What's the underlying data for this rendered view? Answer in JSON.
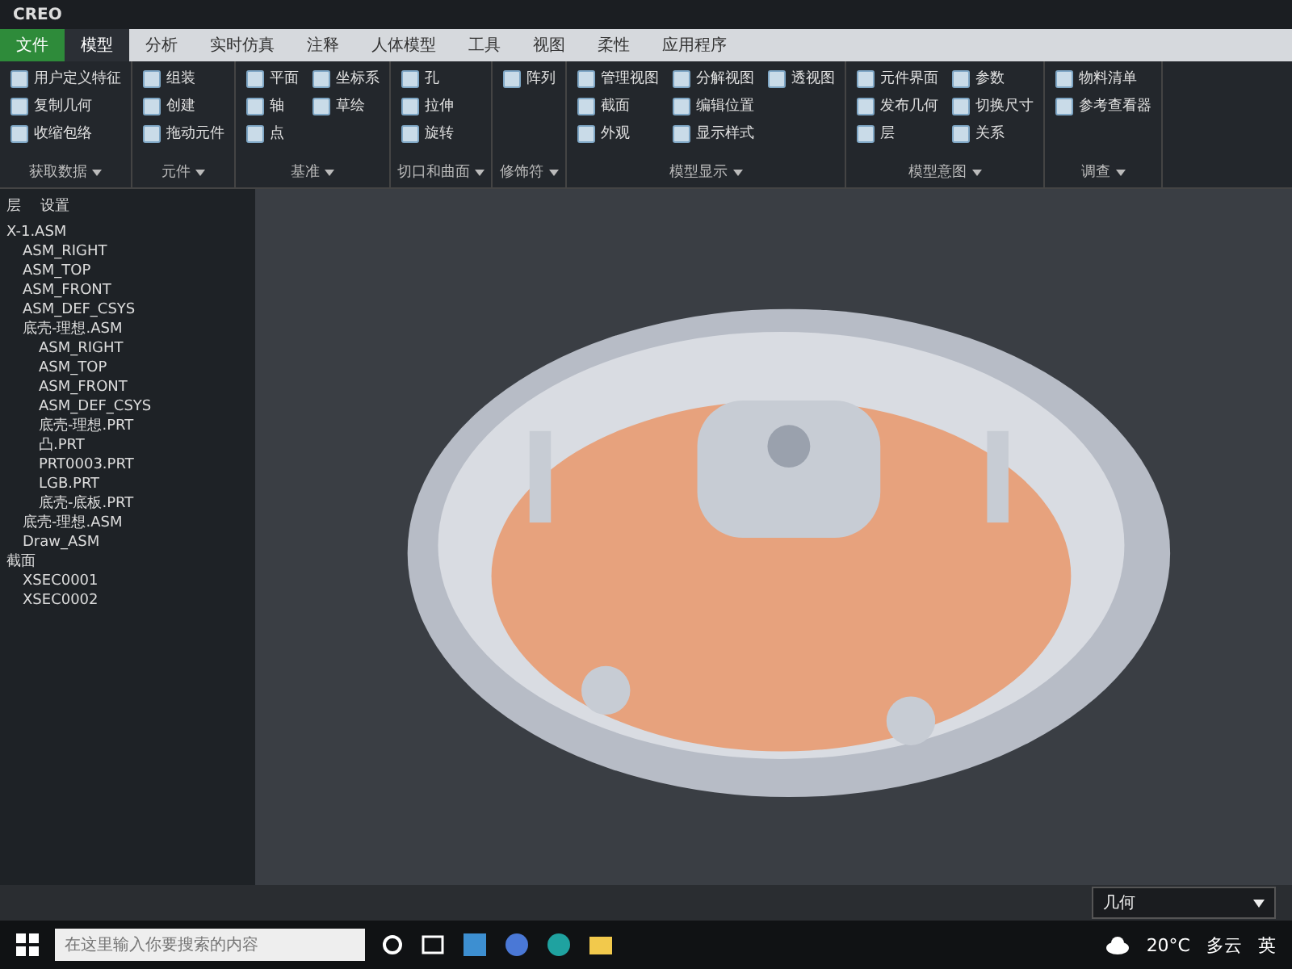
{
  "title_bar": {
    "app": "CREO"
  },
  "tabs": [
    {
      "label": "文件",
      "selected": false,
      "kind": "file"
    },
    {
      "label": "模型",
      "selected": true,
      "kind": "tab"
    },
    {
      "label": "分析",
      "selected": false,
      "kind": "tab"
    },
    {
      "label": "实时仿真",
      "selected": false,
      "kind": "tab"
    },
    {
      "label": "注释",
      "selected": false,
      "kind": "tab"
    },
    {
      "label": "人体模型",
      "selected": false,
      "kind": "tab"
    },
    {
      "label": "工具",
      "selected": false,
      "kind": "tab"
    },
    {
      "label": "视图",
      "selected": false,
      "kind": "tab"
    },
    {
      "label": "柔性",
      "selected": false,
      "kind": "tab"
    },
    {
      "label": "应用程序",
      "selected": false,
      "kind": "tab"
    }
  ],
  "ribbon_groups": [
    {
      "label": "获取数据",
      "items": [
        "用户定义特征",
        "复制几何",
        "收缩包络"
      ]
    },
    {
      "label": "元件",
      "items": [
        "组装",
        "创建",
        "拖动元件"
      ]
    },
    {
      "label": "基准",
      "items": [
        "平面",
        "轴",
        "点",
        "坐标系",
        "草绘"
      ]
    },
    {
      "label": "切口和曲面",
      "items": [
        "孔",
        "拉伸",
        "旋转"
      ]
    },
    {
      "label": "修饰符",
      "items": [
        "阵列"
      ]
    },
    {
      "label": "模型显示",
      "items": [
        "管理视图",
        "截面",
        "外观",
        "分解视图",
        "编辑位置",
        "显示样式",
        "透视图"
      ]
    },
    {
      "label": "模型意图",
      "items": [
        "元件界面",
        "发布几何",
        "层",
        "参数",
        "切换尺寸",
        "关系"
      ]
    },
    {
      "label": "调查",
      "items": [
        "物料清单",
        "参考查看器"
      ]
    }
  ],
  "model_tree": {
    "header": [
      "层",
      "设置"
    ],
    "items": [
      {
        "label": "X-1.ASM",
        "children": [
          {
            "label": "ASM_RIGHT"
          },
          {
            "label": "ASM_TOP"
          },
          {
            "label": "ASM_FRONT"
          },
          {
            "label": "ASM_DEF_CSYS"
          },
          {
            "label": "底壳-理想.ASM",
            "children": [
              {
                "label": "ASM_RIGHT"
              },
              {
                "label": "ASM_TOP"
              },
              {
                "label": "ASM_FRONT"
              },
              {
                "label": "ASM_DEF_CSYS"
              },
              {
                "label": "底壳-理想.PRT"
              },
              {
                "label": "凸.PRT"
              },
              {
                "label": "PRT0003.PRT"
              },
              {
                "label": "LGB.PRT"
              },
              {
                "label": "底壳-底板.PRT"
              }
            ]
          },
          {
            "label": "底壳-理想.ASM"
          },
          {
            "label": "Draw_ASM"
          }
        ]
      },
      {
        "label": "截面",
        "children": [
          {
            "label": "XSEC0001"
          },
          {
            "label": "XSEC0002"
          }
        ]
      }
    ]
  },
  "status_bar": {
    "filter": "几何"
  },
  "taskbar": {
    "search_placeholder": "在这里输入你要搜索的内容",
    "weather": "20°C",
    "condition": "多云",
    "ime": "英"
  }
}
